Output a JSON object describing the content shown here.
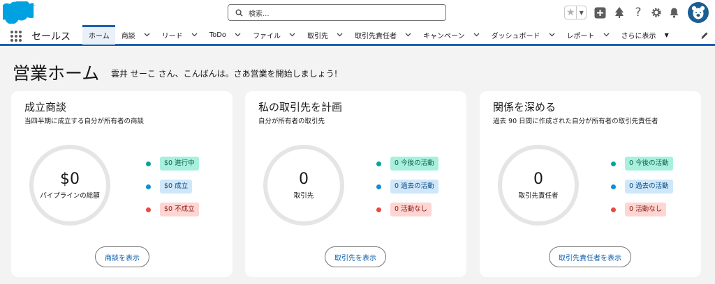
{
  "header": {
    "search_placeholder": "検索...",
    "colors": {
      "brand": "#00a1e0",
      "accent": "#1a5fb4",
      "avatar": "#1b5e91"
    }
  },
  "nav": {
    "app_name": "セールス",
    "tabs": [
      {
        "label": "ホーム",
        "active": true,
        "has_menu": false
      },
      {
        "label": "商談",
        "has_menu": true
      },
      {
        "label": "リード",
        "has_menu": true
      },
      {
        "label": "ToDo",
        "has_menu": true
      },
      {
        "label": "ファイル",
        "has_menu": true
      },
      {
        "label": "取引先",
        "has_menu": true
      },
      {
        "label": "取引先責任者",
        "has_menu": true
      },
      {
        "label": "キャンペーン",
        "has_menu": true
      },
      {
        "label": "ダッシュボード",
        "has_menu": true
      },
      {
        "label": "レポート",
        "has_menu": true
      }
    ],
    "more_label": "さらに表示"
  },
  "page": {
    "title": "営業ホーム",
    "greeting": "雲井 せーこ さん、こんばんは。さあ営業を開始しましょう!"
  },
  "cards": [
    {
      "title": "成立商談",
      "subtitle": "当四半期に成立する自分が所有者の商談",
      "total_value": "$0",
      "total_label": "パイプラインの総額",
      "legend": [
        {
          "label": "$0 進行中",
          "color": "#06a59a",
          "style": "teal"
        },
        {
          "label": "$0 成立",
          "color": "#0b8fd6",
          "style": "blue"
        },
        {
          "label": "$0 不成立",
          "color": "#ea4a3f",
          "style": "red"
        }
      ],
      "button_label": "商談を表示"
    },
    {
      "title": "私の取引先を計画",
      "subtitle": "自分が所有者の取引先",
      "total_value": "0",
      "total_label": "取引先",
      "legend": [
        {
          "label": "0 今後の活動",
          "color": "#06a59a",
          "style": "teal"
        },
        {
          "label": "0 過去の活動",
          "color": "#0b8fd6",
          "style": "blue"
        },
        {
          "label": "0 活動なし",
          "color": "#ea4a3f",
          "style": "red"
        }
      ],
      "button_label": "取引先を表示"
    },
    {
      "title": "関係を深める",
      "subtitle": "過去 90 日間に作成された自分が所有者の取引先責任者",
      "total_value": "0",
      "total_label": "取引先責任者",
      "legend": [
        {
          "label": "0 今後の活動",
          "color": "#06a59a",
          "style": "teal"
        },
        {
          "label": "0 過去の活動",
          "color": "#0b8fd6",
          "style": "blue"
        },
        {
          "label": "0 活動なし",
          "color": "#ea4a3f",
          "style": "red"
        }
      ],
      "button_label": "取引先責任者を表示"
    }
  ]
}
